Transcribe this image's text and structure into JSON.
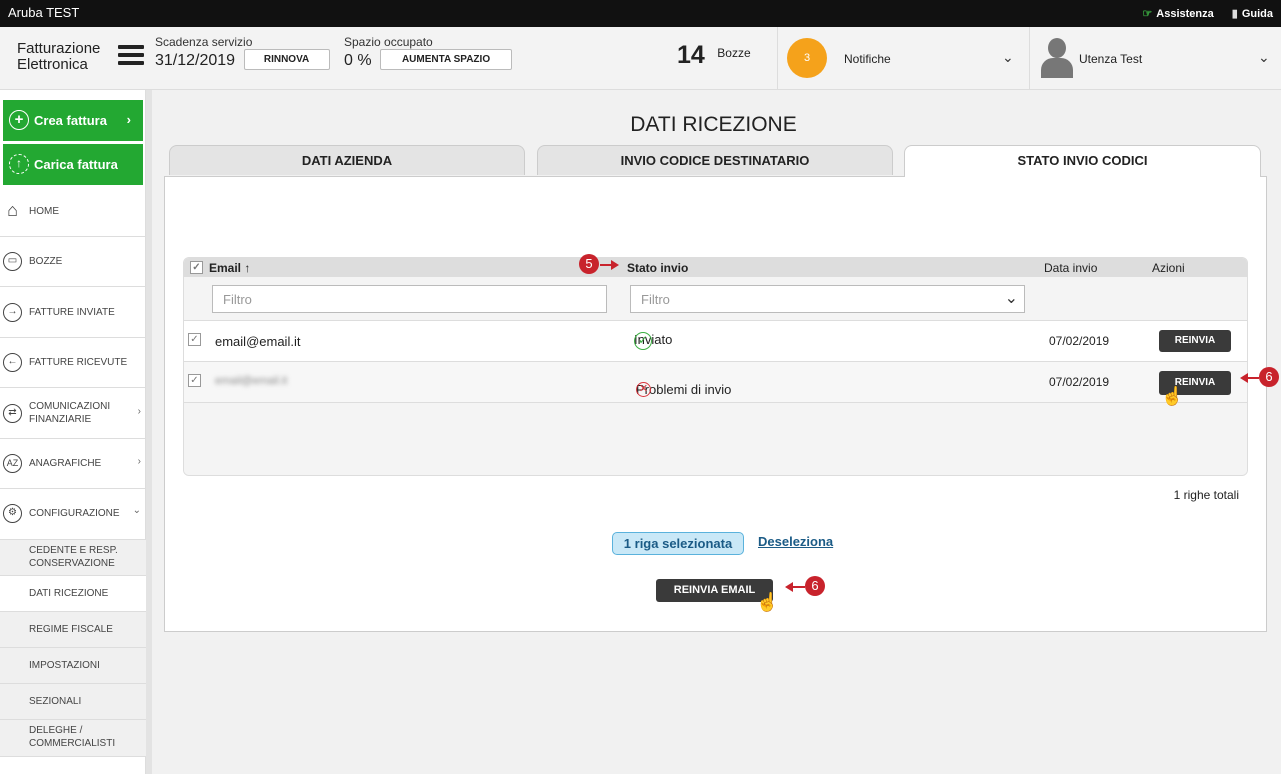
{
  "topbar": {
    "app_title": "Aruba TEST",
    "assistenza": "Assistenza",
    "guida": "Guida"
  },
  "header": {
    "logo_line1": "Fatturazione",
    "logo_line2": "Elettronica",
    "scadenza_label": "Scadenza servizio",
    "scadenza_value": "31/12/2019",
    "rinnova": "RINNOVA",
    "spazio_label": "Spazio occupato",
    "spazio_value": "0 %",
    "aumenta": "AUMENTA SPAZIO",
    "bozze_count": "14",
    "bozze_label": "Bozze",
    "notifiche_count": "3",
    "notifiche_label": "Notifiche",
    "user_name": "Utenza Test"
  },
  "sidebar": {
    "crea": "Crea fattura",
    "carica": "Carica fattura",
    "items": [
      {
        "label": "HOME"
      },
      {
        "label": "BOZZE"
      },
      {
        "label": "FATTURE INVIATE"
      },
      {
        "label": "FATTURE RICEVUTE"
      },
      {
        "label1": "COMUNICAZIONI",
        "label2": "FINANZIARIE"
      },
      {
        "label": "ANAGRAFICHE"
      },
      {
        "label": "CONFIGURAZIONE"
      }
    ],
    "sub": [
      {
        "label1": "CEDENTE E RESP.",
        "label2": "CONSERVAZIONE"
      },
      {
        "label": "DATI RICEZIONE"
      },
      {
        "label": "REGIME FISCALE"
      },
      {
        "label": "IMPOSTAZIONI"
      },
      {
        "label": "SEZIONALI"
      },
      {
        "label1": "DELEGHE /",
        "label2": "COMMERCIALISTI"
      }
    ]
  },
  "main": {
    "title": "DATI RICEZIONE",
    "tabs": [
      "DATI AZIENDA",
      "INVIO CODICE DESTINATARIO",
      "STATO INVIO CODICI"
    ],
    "columns": {
      "email": "Email",
      "sort_indicator": "↑",
      "stato": "Stato invio",
      "data": "Data invio",
      "azioni": "Azioni"
    },
    "filter_placeholder": "Filtro",
    "rows": [
      {
        "email": "email@email.it",
        "stato": "Inviato",
        "data": "07/02/2019",
        "azione": "REINVIA"
      },
      {
        "email": "email@email.it",
        "stato": "Problemi di invio",
        "data": "07/02/2019",
        "azione": "REINVIA"
      }
    ],
    "total": "1 righe totali",
    "selected": "1 riga selezionata",
    "deselect": "Deseleziona",
    "resend_email": "REINVIA EMAIL"
  },
  "annotations": {
    "a5": "5",
    "a6": "6"
  },
  "colors": {
    "accent_green": "#23a832",
    "badge_orange": "#f5a21b",
    "annotation_red": "#c8232c"
  }
}
